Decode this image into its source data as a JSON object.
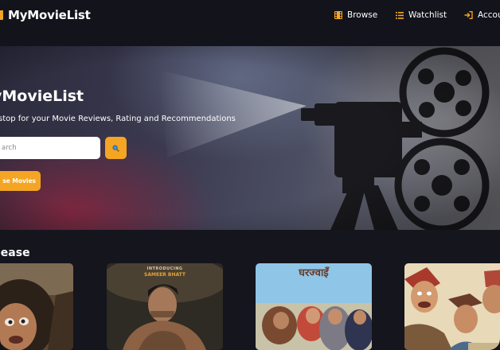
{
  "navbar": {
    "brand": "MyMovieList",
    "links": [
      {
        "label": "Browse",
        "icon": "film-icon"
      },
      {
        "label": "Watchlist",
        "icon": "list-icon"
      },
      {
        "label": "Accou",
        "icon": "login-icon"
      }
    ]
  },
  "hero": {
    "title": "yMovieList",
    "subtitle": "stop for your Movie Reviews, Rating and Recommendations",
    "search": {
      "placeholder": "arch",
      "button_icon": "search-icon"
    },
    "browse_button": "se Movies"
  },
  "new_release": {
    "title": "lease",
    "posters": [
      {
        "caption": ""
      },
      {
        "caption_top": "INTRODUCING",
        "caption_bottom": "SAMEER BHATT"
      },
      {
        "caption": "घरज्वाइँ"
      },
      {
        "caption": ""
      }
    ]
  },
  "colors": {
    "background": "#14141c",
    "accent": "#f5a524",
    "text": "#ffffff"
  }
}
